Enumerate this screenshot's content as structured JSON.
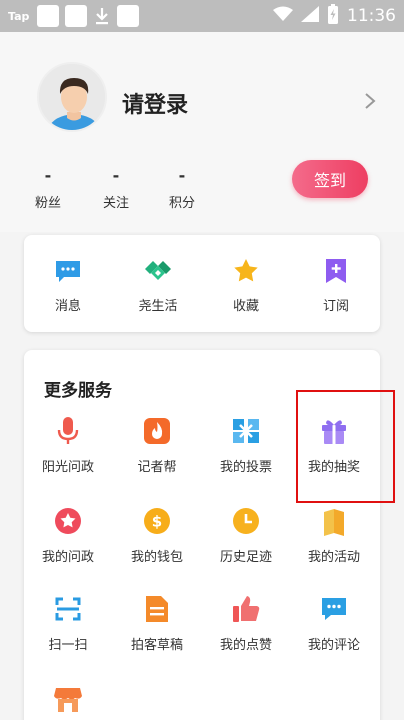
{
  "status_bar": {
    "app_label": "Tap",
    "time": "11:36"
  },
  "profile": {
    "login_text": "请登录",
    "stats": [
      {
        "value": "-",
        "label": "粉丝"
      },
      {
        "value": "-",
        "label": "关注"
      },
      {
        "value": "-",
        "label": "积分"
      }
    ],
    "checkin_label": "签到"
  },
  "quick": [
    {
      "label": "消息",
      "icon": "message-icon",
      "color": "#2f9be6"
    },
    {
      "label": "尧生活",
      "icon": "handshake-icon",
      "color": "#22b07d"
    },
    {
      "label": "收藏",
      "icon": "star-icon",
      "color": "#f7b51b"
    },
    {
      "label": "订阅",
      "icon": "subscribe-icon",
      "color": "#8e5cf0"
    }
  ],
  "more": {
    "title": "更多服务",
    "items": [
      {
        "label": "阳光问政",
        "icon": "microphone-icon",
        "color": "#ef5a4e"
      },
      {
        "label": "记者帮",
        "icon": "flame-icon",
        "color": "#f46a2a"
      },
      {
        "label": "我的投票",
        "icon": "vote-icon",
        "color": "#2a9fe3"
      },
      {
        "label": "我的抽奖",
        "icon": "gift-icon",
        "color": "#8f6ef0"
      },
      {
        "label": "我的问政",
        "icon": "star-badge-icon",
        "color": "#ef4b5c"
      },
      {
        "label": "我的钱包",
        "icon": "wallet-icon",
        "color": "#f7ad1a"
      },
      {
        "label": "历史足迹",
        "icon": "clock-icon",
        "color": "#f7b11e"
      },
      {
        "label": "我的活动",
        "icon": "flag-icon",
        "color": "#f3b52a"
      },
      {
        "label": "扫一扫",
        "icon": "scan-icon",
        "color": "#2a9be2"
      },
      {
        "label": "拍客草稿",
        "icon": "draft-icon",
        "color": "#f48a2a"
      },
      {
        "label": "我的点赞",
        "icon": "thumbs-up-icon",
        "color": "#ef5656"
      },
      {
        "label": "我的评论",
        "icon": "comment-icon",
        "color": "#2a9fe3"
      },
      {
        "label": "",
        "icon": "shop-icon",
        "color": "#f47a3a"
      }
    ]
  }
}
